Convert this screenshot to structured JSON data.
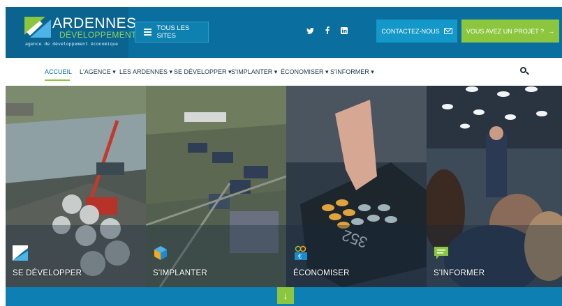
{
  "brand": {
    "title": "ARDENNES",
    "subtitle": "DÉVELOPPEMENT",
    "tagline": "agence de développement économique"
  },
  "header": {
    "all_sites_label": "TOUS LES SITES",
    "contact_label": "CONTACTEZ-NOUS",
    "project_label": "VOUS AVEZ UN PROJET ?",
    "social": [
      "twitter-icon",
      "facebook-icon",
      "linkedin-icon"
    ]
  },
  "nav": {
    "items": [
      {
        "label": "ACCUEIL"
      },
      {
        "label": "L'AGENCE ▾"
      },
      {
        "label": "LES ARDENNES ▾"
      },
      {
        "label": "SE DÉVELOPPER ▾"
      },
      {
        "label": "S'IMPLANTER ▾"
      },
      {
        "label": "ÉCONOMISER ▾"
      },
      {
        "label": "S'INFORMER ▾"
      }
    ]
  },
  "panels": [
    {
      "label": "SE DÉVELOPPER",
      "icon": "growth-chart-icon"
    },
    {
      "label": "S'IMPLANTER",
      "icon": "building-cube-icon"
    },
    {
      "label": "ÉCONOMISER",
      "icon": "euro-coins-icon"
    },
    {
      "label": "S'INFORMER",
      "icon": "chat-bubble-icon"
    }
  ],
  "colors": {
    "header_blue": "#0a6f9e",
    "accent_green": "#8cc63f",
    "contact_blue": "#1497c9"
  }
}
